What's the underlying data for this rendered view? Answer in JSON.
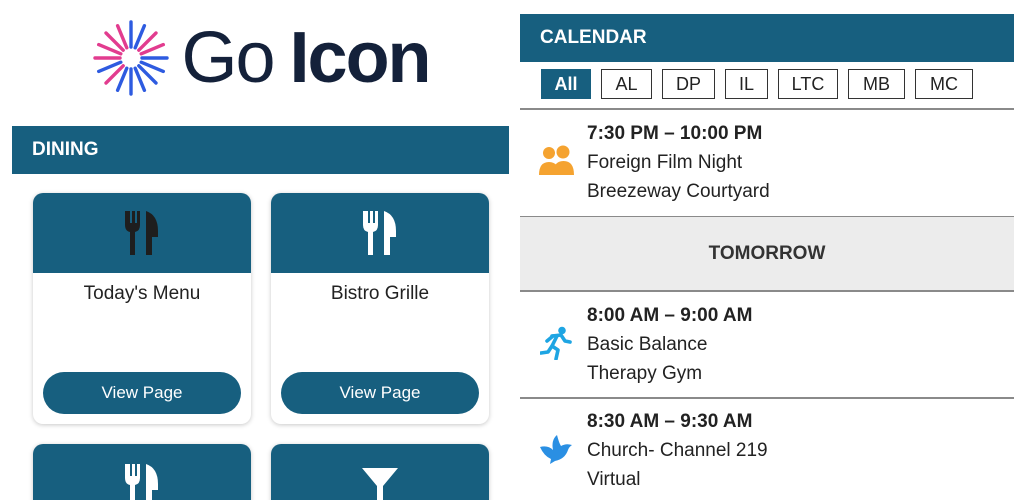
{
  "logo": {
    "word1": "Go",
    "word2": "Icon",
    "burst_colors": [
      "#e23c8f",
      "#2e5be0"
    ]
  },
  "colors": {
    "accent": "#175f7f",
    "orange": "#f5a330",
    "cyan": "#1ea5e3"
  },
  "dining": {
    "header": "DINING",
    "cards": [
      {
        "title": "Today's Menu",
        "button": "View Page",
        "icon": "fork-knife-icon"
      },
      {
        "title": "Bistro Grille",
        "button": "View Page",
        "icon": "fork-knife-icon"
      },
      {
        "title": "",
        "button": "",
        "icon": "fork-knife-icon"
      },
      {
        "title": "",
        "button": "",
        "icon": "cocktail-glass-icon"
      }
    ]
  },
  "calendar": {
    "header": "CALENDAR",
    "filters": [
      "All",
      "AL",
      "DP",
      "IL",
      "LTC",
      "MB",
      "MC"
    ],
    "active_filter": "All",
    "events_today": [
      {
        "time": "7:30 PM – 10:00 PM",
        "title": "Foreign Film Night",
        "location": "Breezeway Courtyard",
        "icon": "people-icon"
      }
    ],
    "tomorrow_label": "TOMORROW",
    "events_tomorrow": [
      {
        "time": "8:00 AM – 9:00 AM",
        "title": "Basic Balance",
        "location": "Therapy Gym",
        "icon": "running-icon"
      },
      {
        "time": "8:30 AM – 9:30 AM",
        "title": "Church- Channel 219",
        "location": "Virtual",
        "icon": "dove-icon"
      }
    ]
  }
}
